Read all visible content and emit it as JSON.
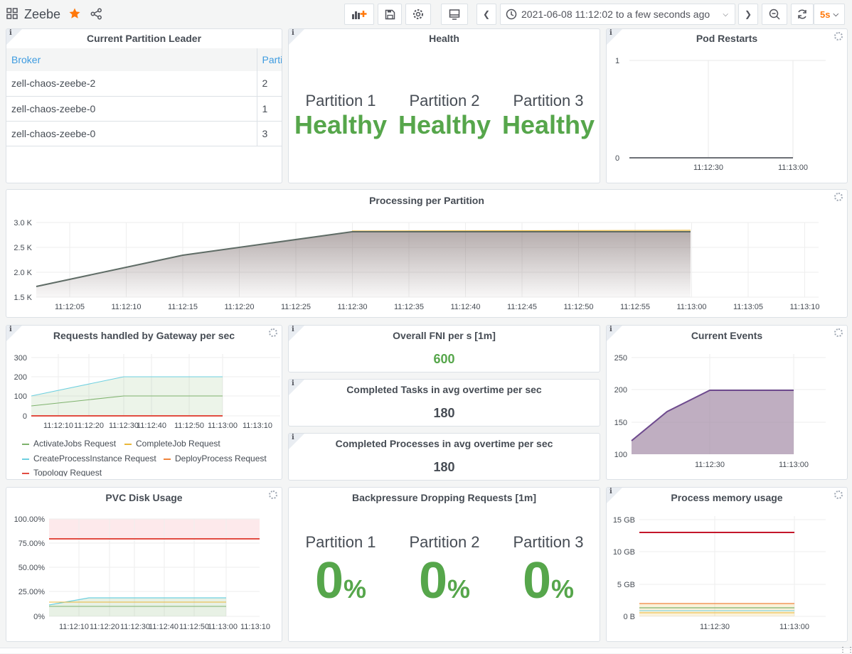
{
  "app": {
    "title": "Zeebe"
  },
  "toolbar": {
    "time_range": "2021-06-08 11:12:02 to a few seconds ago",
    "refresh_interval": "5s"
  },
  "panels": {
    "leader": {
      "title": "Current Partition Leader",
      "columns": [
        "Broker",
        "Parti"
      ],
      "rows": [
        [
          "zell-chaos-zeebe-2",
          "2"
        ],
        [
          "zell-chaos-zeebe-0",
          "1"
        ],
        [
          "zell-chaos-zeebe-0",
          "3"
        ]
      ]
    },
    "health": {
      "title": "Health",
      "items": [
        {
          "label": "Partition 1",
          "value": "Healthy"
        },
        {
          "label": "Partition 2",
          "value": "Healthy"
        },
        {
          "label": "Partition 3",
          "value": "Healthy"
        }
      ]
    },
    "pod_restarts": {
      "title": "Pod Restarts"
    },
    "processing": {
      "title": "Processing per Partition"
    },
    "gateway": {
      "title": "Requests handled by Gateway per sec"
    },
    "fni": {
      "title": "Overall FNI per s [1m]",
      "value": "600"
    },
    "tasks": {
      "title": "Completed Tasks in avg overtime per sec",
      "value": "180"
    },
    "processes": {
      "title": "Completed Processes in avg overtime per sec",
      "value": "180"
    },
    "events": {
      "title": "Current Events"
    },
    "pvc": {
      "title": "PVC Disk Usage"
    },
    "backpressure": {
      "title": "Backpressure Dropping Requests [1m]",
      "items": [
        {
          "label": "Partition 1",
          "value": "0",
          "unit": "%"
        },
        {
          "label": "Partition 2",
          "value": "0",
          "unit": "%"
        },
        {
          "label": "Partition 3",
          "value": "0",
          "unit": "%"
        }
      ]
    },
    "memory": {
      "title": "Process memory usage"
    }
  },
  "colors": {
    "green": "#56a64b",
    "accent": "#ff780a",
    "link": "#3d9be0"
  },
  "chart_data": [
    {
      "id": "pod_restarts",
      "type": "line",
      "x": [
        "11:12:02",
        "11:13:10"
      ],
      "xticks": [
        "11:12:30",
        "11:13:00"
      ],
      "yticks": [
        "0",
        "1"
      ],
      "ylim": [
        0,
        1
      ],
      "series": [
        {
          "values": [
            0,
            0
          ]
        }
      ]
    },
    {
      "id": "processing",
      "type": "area",
      "x": [
        "11:12:02",
        "11:12:15",
        "11:12:30",
        "11:12:45",
        "11:13:00"
      ],
      "xticks": [
        "11:12:05",
        "11:12:10",
        "11:12:15",
        "11:12:20",
        "11:12:25",
        "11:12:30",
        "11:12:35",
        "11:12:40",
        "11:12:45",
        "11:12:50",
        "11:12:55",
        "11:13:00",
        "11:13:05",
        "11:13:10"
      ],
      "yticks": [
        "1.5 K",
        "2.0 K",
        "2.5 K",
        "3.0 K"
      ],
      "ylim": [
        1500,
        3200
      ],
      "series": [
        {
          "values": [
            1720,
            2340,
            2830,
            2830,
            2830
          ]
        }
      ]
    },
    {
      "id": "gateway",
      "type": "area",
      "xticks": [
        "11:12:10",
        "11:12:20",
        "11:12:30",
        "11:12:40",
        "11:12:50",
        "11:13:00",
        "11:13:10"
      ],
      "yticks": [
        "0",
        "100",
        "200",
        "300"
      ],
      "ylim": [
        0,
        300
      ],
      "legend": [
        {
          "name": "ActivateJobs Request",
          "color": "#7eb26d"
        },
        {
          "name": "CompleteJob Request",
          "color": "#eab839"
        },
        {
          "name": "CreateProcessInstance Request",
          "color": "#6ed0e0"
        },
        {
          "name": "DeployProcess Request",
          "color": "#ef843c"
        },
        {
          "name": "Topology Request",
          "color": "#e24d42"
        }
      ],
      "series": [
        {
          "name": "CreateProcessInstance Request",
          "values": [
            100,
            200,
            200,
            200
          ]
        },
        {
          "name": "ActivateJobs Request",
          "values": [
            50,
            100,
            100,
            100
          ]
        },
        {
          "name": "Topology Request",
          "values": [
            0,
            0,
            0,
            0
          ]
        }
      ]
    },
    {
      "id": "events",
      "type": "area",
      "xticks": [
        "11:12:30",
        "11:13:00"
      ],
      "yticks": [
        "100",
        "150",
        "200",
        "250"
      ],
      "ylim": [
        100,
        250
      ],
      "series": [
        {
          "values": [
            120,
            165,
            200,
            200
          ]
        }
      ]
    },
    {
      "id": "pvc",
      "type": "line",
      "xticks": [
        "11:12:10",
        "11:12:20",
        "11:12:30",
        "11:12:40",
        "11:12:50",
        "11:13:00",
        "11:13:10"
      ],
      "yticks": [
        "0%",
        "25.00%",
        "50.00%",
        "75.00%",
        "100.00%"
      ],
      "ylim": [
        0,
        100
      ],
      "series": [
        {
          "values": [
            80,
            80,
            80
          ]
        },
        {
          "values": [
            12,
            19,
            19
          ]
        },
        {
          "values": [
            15,
            15,
            15
          ]
        },
        {
          "values": [
            10,
            10,
            10
          ]
        }
      ]
    },
    {
      "id": "memory",
      "type": "line",
      "xticks": [
        "11:12:30",
        "11:13:00"
      ],
      "yticks": [
        "0 B",
        "5 GB",
        "10 GB",
        "15 GB"
      ],
      "ylim": [
        0,
        15
      ],
      "series": [
        {
          "values": [
            12.9,
            12.9,
            12.9
          ]
        },
        {
          "values": [
            2.0,
            2.0,
            2.0
          ]
        },
        {
          "values": [
            1.3,
            1.3,
            1.3
          ]
        },
        {
          "values": [
            0.9,
            0.9,
            0.9
          ]
        }
      ]
    }
  ]
}
